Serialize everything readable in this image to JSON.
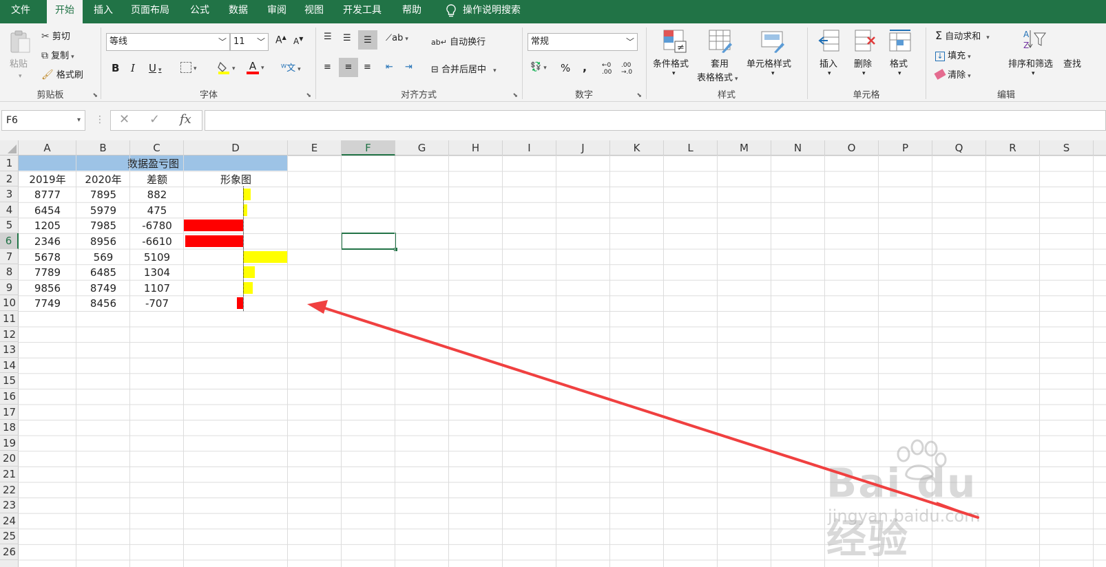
{
  "tabs": [
    "文件",
    "开始",
    "插入",
    "页面布局",
    "公式",
    "数据",
    "审阅",
    "视图",
    "开发工具",
    "帮助"
  ],
  "active_tab": "开始",
  "tell_me": "操作说明搜索",
  "clipboard": {
    "paste": "粘贴",
    "cut": "剪切",
    "copy": "复制",
    "format_painter": "格式刷",
    "label": "剪贴板"
  },
  "font": {
    "name": "等线",
    "size": "11",
    "bold": "B",
    "italic": "I",
    "underline": "U",
    "label": "字体",
    "font_color": "A",
    "grow": "A",
    "shrink": "A"
  },
  "alignment": {
    "wrap": "自动换行",
    "merge": "合并后居中",
    "label": "对齐方式"
  },
  "number": {
    "format": "常规",
    "percent": "%",
    "comma": ",",
    "label": "数字"
  },
  "styles": {
    "conditional": "条件格式",
    "table_line1": "套用",
    "table_line2": "表格格式",
    "cell_styles": "单元格样式",
    "label": "样式"
  },
  "cells_group": {
    "insert": "插入",
    "delete": "删除",
    "format": "格式",
    "label": "单元格"
  },
  "editing": {
    "autosum": "自动求和",
    "fill": "填充",
    "clear": "清除",
    "sort": "排序和筛选",
    "find": "查找",
    "label": "编辑"
  },
  "name_box": "F6",
  "fx": "fx",
  "columns": [
    "A",
    "B",
    "C",
    "D",
    "E",
    "F",
    "G",
    "H",
    "I",
    "J",
    "K",
    "L",
    "M",
    "N",
    "O",
    "P",
    "Q",
    "R",
    "S"
  ],
  "selected_column": "F",
  "rows": [
    "1",
    "2",
    "3",
    "4",
    "5",
    "6",
    "7",
    "8",
    "9",
    "10",
    "11",
    "12",
    "13",
    "14",
    "15",
    "16",
    "17",
    "18",
    "19",
    "20",
    "21",
    "22",
    "23",
    "24",
    "25",
    "26"
  ],
  "selected_row": "6",
  "sheet": {
    "title": "数据盈亏图",
    "headers": [
      "2019年",
      "2020年",
      "差额",
      "形象图"
    ],
    "data": [
      {
        "a": "8777",
        "b": "7895",
        "c": "882",
        "diff": 882
      },
      {
        "a": "6454",
        "b": "5979",
        "c": "475",
        "diff": 475
      },
      {
        "a": "1205",
        "b": "7985",
        "c": "-6780",
        "diff": -6780
      },
      {
        "a": "2346",
        "b": "8956",
        "c": "-6610",
        "diff": -6610
      },
      {
        "a": "5678",
        "b": "569",
        "c": "5109",
        "diff": 5109
      },
      {
        "a": "7789",
        "b": "6485",
        "c": "1304",
        "diff": 1304
      },
      {
        "a": "9856",
        "b": "8749",
        "c": "1107",
        "diff": 1107
      },
      {
        "a": "7749",
        "b": "8456",
        "c": "-707",
        "diff": -707
      }
    ],
    "positive_color": "#ffff00",
    "negative_color": "#ff0000",
    "title_fill": "#9dc3e6"
  },
  "accent_color": "#217346",
  "watermark": {
    "line1": "Bai du 经验",
    "line2": "jingyan.baidu.com"
  }
}
